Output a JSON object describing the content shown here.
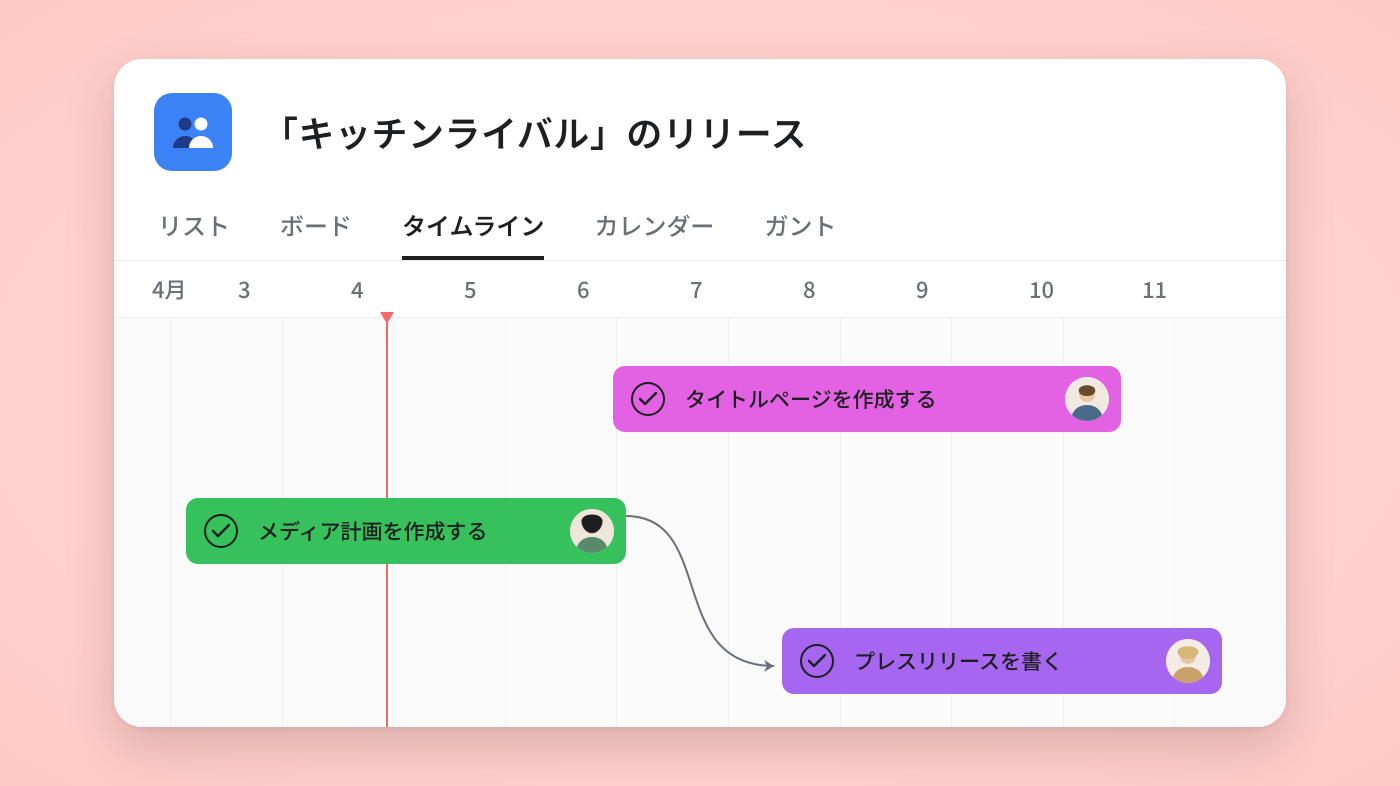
{
  "header": {
    "title": "「キッチンライバル」のリリース",
    "icon": "people-icon"
  },
  "tabs": [
    {
      "label": "リスト",
      "active": false
    },
    {
      "label": "ボード",
      "active": false
    },
    {
      "label": "タイムライン",
      "active": true
    },
    {
      "label": "カレンダー",
      "active": false
    },
    {
      "label": "ガント",
      "active": false
    }
  ],
  "timeline": {
    "month_label": "4月",
    "days": [
      "3",
      "4",
      "5",
      "6",
      "7",
      "8",
      "9",
      "10",
      "11"
    ],
    "current_day": "4",
    "tasks": [
      {
        "id": "t1",
        "label": "タイトルページを作成する",
        "color": "magenta",
        "start_day": "6",
        "end_day": "10",
        "row": 0,
        "completed": true,
        "assignee": "user-a"
      },
      {
        "id": "t2",
        "label": "メディア計画を作成する",
        "color": "green",
        "start_day": "3",
        "end_day": "6",
        "row": 1,
        "completed": true,
        "assignee": "user-b"
      },
      {
        "id": "t3",
        "label": "プレスリリースを書く",
        "color": "purple",
        "start_day": "7",
        "end_day": "11",
        "row": 2,
        "completed": true,
        "assignee": "user-c"
      }
    ],
    "dependencies": [
      {
        "from": "t2",
        "to": "t3"
      }
    ]
  },
  "colors": {
    "magenta": "#e362e3",
    "green": "#37c15c",
    "purple": "#a666ef",
    "now": "#f06a6a"
  }
}
